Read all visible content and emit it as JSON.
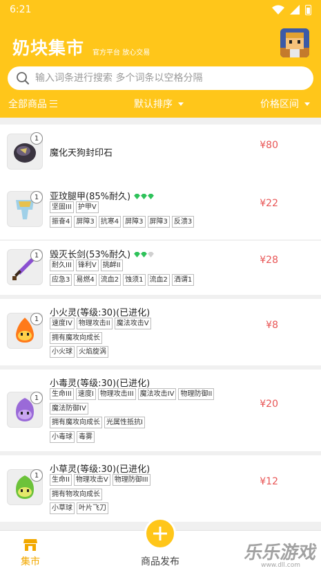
{
  "status": {
    "time": "6:21"
  },
  "brand": {
    "title": "奶块集市",
    "subtitle": "官方平台 放心交易"
  },
  "search": {
    "placeholder": "输入词条进行搜索 多个词条以空格分隔"
  },
  "filters": {
    "all": "全部商品",
    "sort": "默认排序",
    "price": "价格区间"
  },
  "items": [
    {
      "qty": "1",
      "name": "魔化天狗封印石",
      "price": "¥80",
      "rows": []
    },
    {
      "qty": "1",
      "name": "亚玟腿甲(85%耐久)",
      "price": "¥22",
      "gems": [
        "#2ec25a",
        "#2ec25a",
        "#2ec25a"
      ],
      "rows": [
        [
          "坚固III",
          "护甲V"
        ],
        [
          "振奋4",
          "屏障3",
          "抗寒4",
          "屏障3",
          "屏障3",
          "反溃3"
        ]
      ]
    },
    {
      "qty": "1",
      "name": "毁灭长剑(53%耐久)",
      "price": "¥28",
      "gems": [
        "#2ec25a",
        "#2ec25a",
        "#d0d0d0"
      ],
      "rows": [
        [
          "耐久III",
          "锋利V",
          "挑衅II"
        ],
        [
          "应急3",
          "易燃4",
          "流血2",
          "蚀须1",
          "流血2",
          "洒谓1"
        ]
      ]
    },
    {
      "qty": "1",
      "name": "小火灵(等级:30)(已进化)",
      "price": "¥8",
      "rows": [
        [
          "速度IV",
          "物理攻击II",
          "魔法攻击V"
        ],
        [
          "拥有魔攻向成长"
        ],
        [
          "小火球",
          "火焰旋涡"
        ]
      ]
    },
    {
      "qty": "1",
      "name": "小毒灵(等级:30)(已进化)",
      "price": "¥20",
      "rows": [
        [
          "生命III",
          "速度I",
          "物理攻击III",
          "魔法攻击IV",
          "物理防御II"
        ],
        [
          "魔法防御IV"
        ],
        [
          "拥有魔攻向成长",
          "光属性抵抗I"
        ],
        [
          "小毒球",
          "毒雾"
        ]
      ]
    },
    {
      "qty": "1",
      "name": "小草灵(等级:30)(已进化)",
      "price": "¥12",
      "rows": [
        [
          "生命II",
          "物理攻击V",
          "物理防御III"
        ],
        [
          "拥有物攻向成长"
        ],
        [
          "小草球",
          "叶片飞刀"
        ]
      ]
    }
  ],
  "nav": {
    "market": "集市",
    "publish": "商品发布"
  },
  "watermark": {
    "text": "乐乐游戏",
    "url": "www.dll.com"
  },
  "colors": {
    "brand": "#ffc61a",
    "price": "#e85454",
    "gem_green": "#2ec25a"
  }
}
